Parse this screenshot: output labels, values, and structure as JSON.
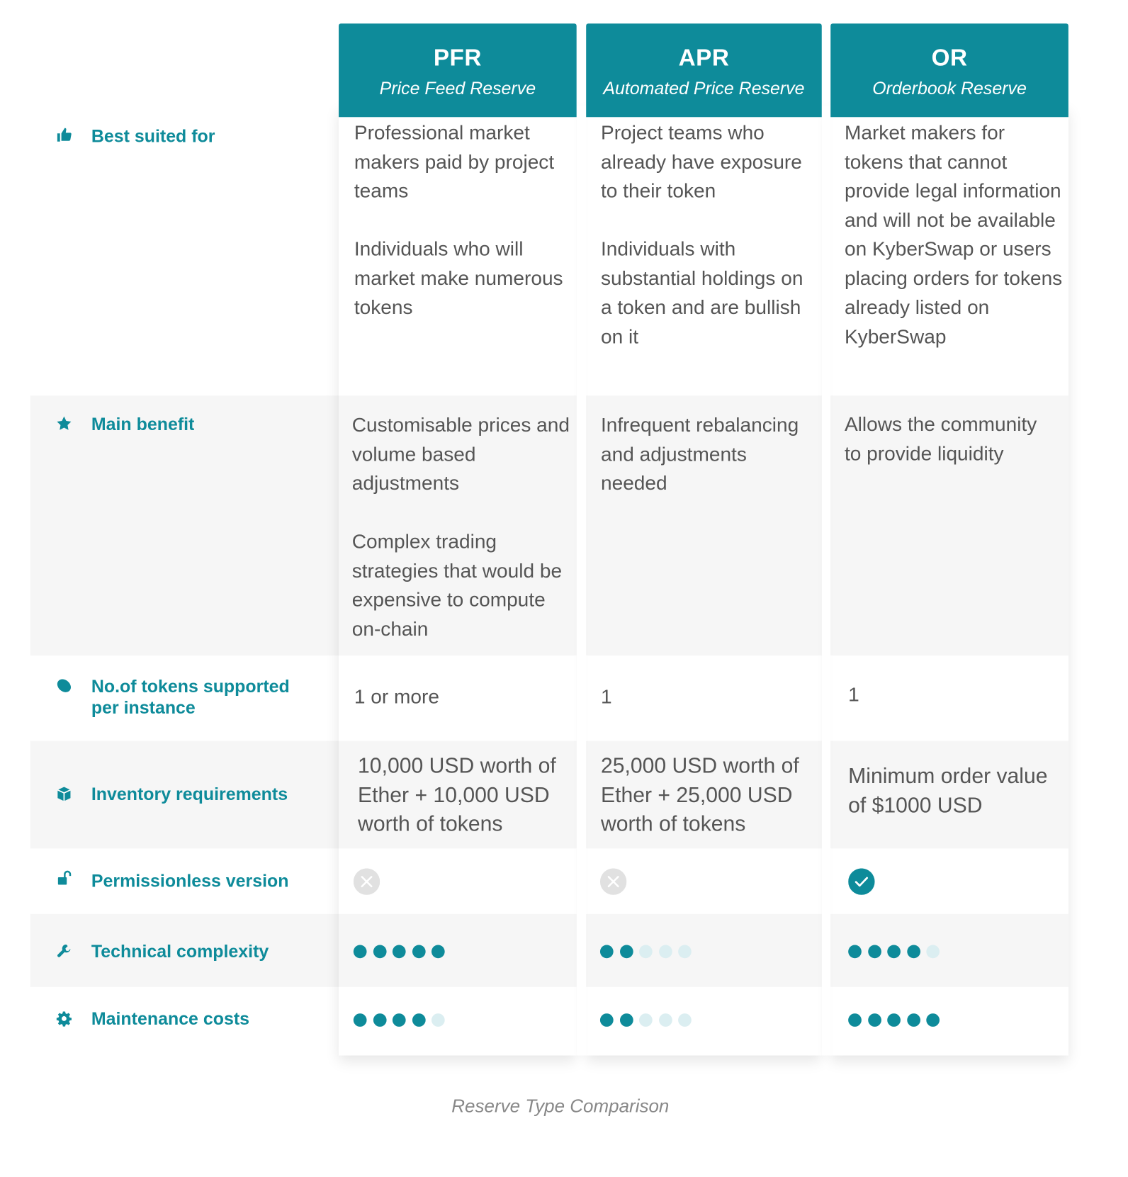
{
  "columns": [
    {
      "code": "PFR",
      "name": "Price Feed Reserve"
    },
    {
      "code": "APR",
      "name": "Automated Price Reserve"
    },
    {
      "code": "OR",
      "name": "Orderbook Reserve"
    }
  ],
  "rows": {
    "best_suited": {
      "label": "Best suited for",
      "icon": "thumbs-up-icon",
      "cells": [
        [
          "Professional market makers paid by project teams",
          "Individuals who will market make numerous tokens"
        ],
        [
          "Project teams who already have exposure to their token",
          "Individuals with substantial holdings on a token and are bullish on it"
        ],
        [
          "Market makers for tokens that cannot provide legal information and will not be available on KyberSwap or users placing orders for tokens already listed on KyberSwap"
        ]
      ]
    },
    "main_benefit": {
      "label": "Main benefit",
      "icon": "star-icon",
      "cells": [
        [
          "Customisable prices and volume based adjustments",
          "Complex trading strategies that would be expensive to compute on-chain"
        ],
        [
          "Infrequent rebalancing and adjustments needed"
        ],
        [
          "Allows the community to provide liquidity"
        ]
      ]
    },
    "tokens_supported": {
      "label_line1": "No.of tokens supported",
      "label_line2": "per instance",
      "icon": "tag-icon",
      "cells": [
        "1 or more",
        "1",
        "1"
      ]
    },
    "inventory": {
      "label": "Inventory requirements",
      "icon": "box-icon",
      "cells": [
        "10,000 USD worth of Ether + 10,000 USD worth of tokens",
        "25,000 USD worth of Ether + 25,000 USD worth of tokens",
        "Minimum order value of $1000 USD"
      ]
    },
    "permissionless": {
      "label": "Permissionless version",
      "icon": "unlock-icon",
      "values": [
        false,
        false,
        true
      ]
    },
    "technical_complexity": {
      "label": "Technical complexity",
      "icon": "wrench-icon",
      "values": [
        5,
        2,
        4
      ],
      "max": 5
    },
    "maintenance_costs": {
      "label": "Maintenance costs",
      "icon": "gear-icon",
      "values": [
        4,
        2,
        5
      ],
      "max": 5
    }
  },
  "colors": {
    "accent": "#0e8b9a",
    "dot_off": "#dbeef1",
    "x_circle": "#e1e1e1"
  },
  "caption": "Reserve Type Comparison"
}
